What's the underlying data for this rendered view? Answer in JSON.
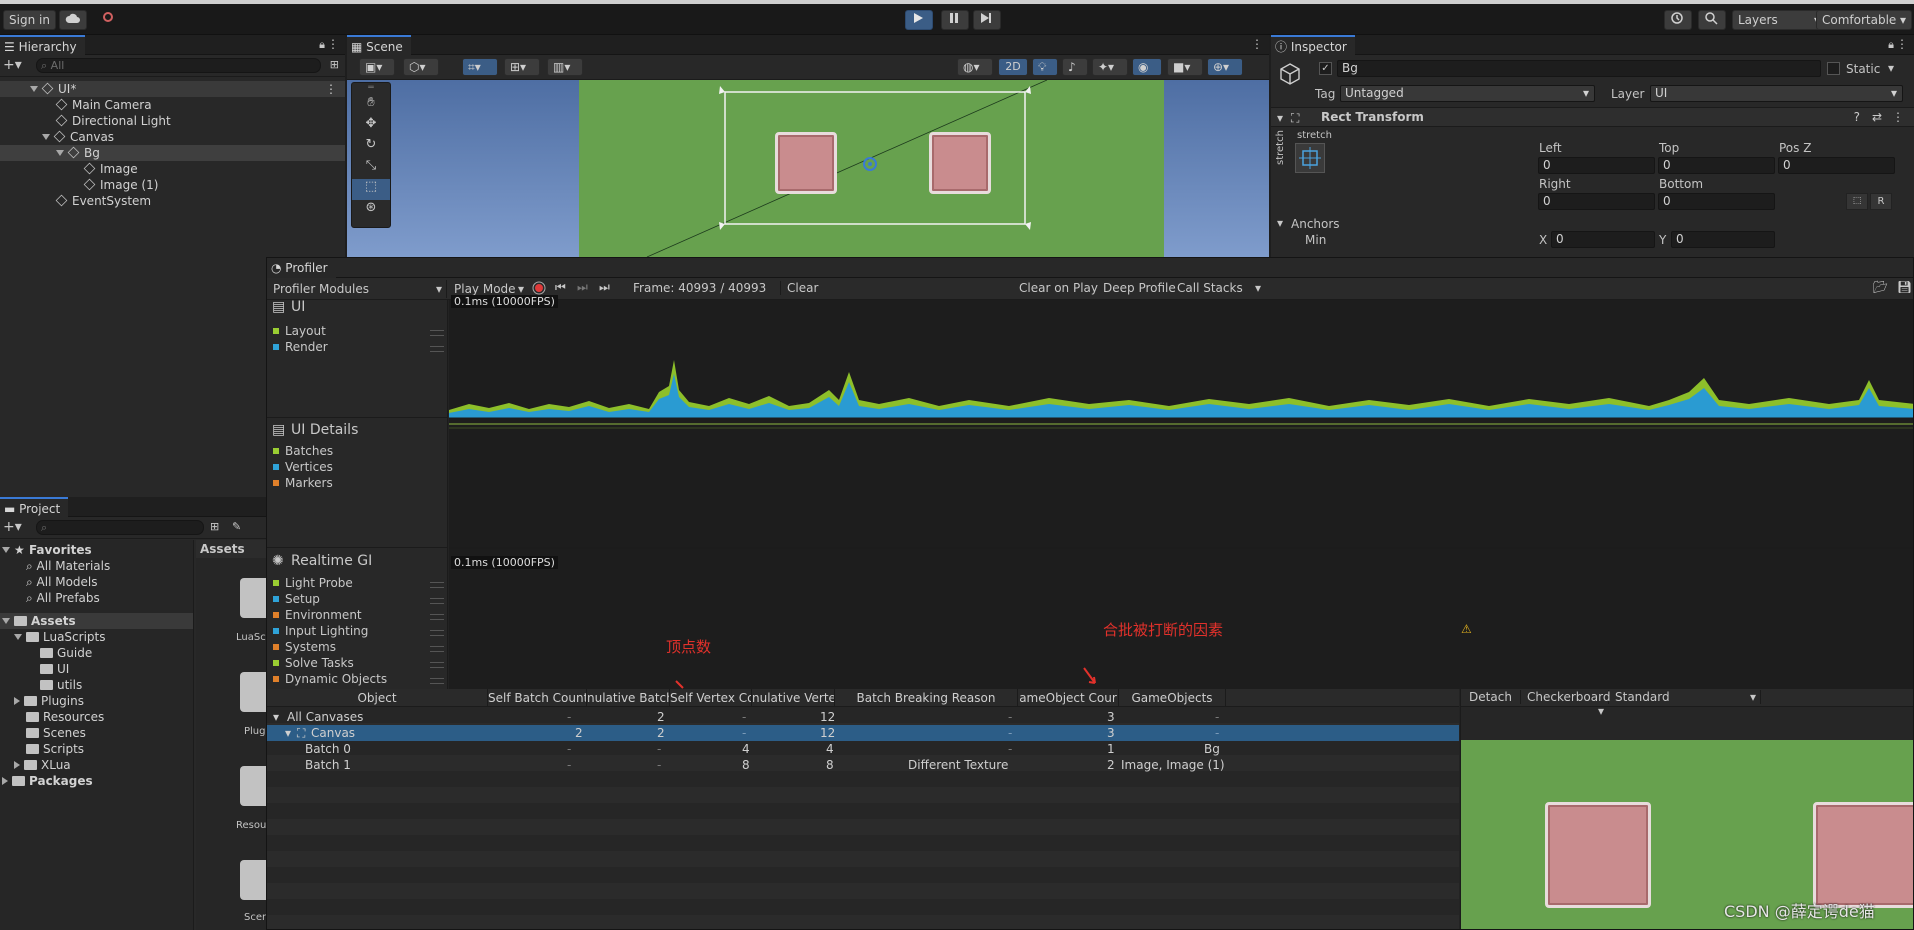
{
  "toolbar": {
    "sign_in": "Sign in",
    "layers": "Layers",
    "layout": "Comfortable"
  },
  "hierarchy": {
    "tab": "Hierarchy",
    "search_placeholder": "All",
    "items": [
      {
        "label": "UI*"
      },
      {
        "label": "Main Camera"
      },
      {
        "label": "Directional Light"
      },
      {
        "label": "Canvas"
      },
      {
        "label": "Bg"
      },
      {
        "label": "Image"
      },
      {
        "label": "Image (1)"
      },
      {
        "label": "EventSystem"
      }
    ]
  },
  "scene": {
    "tab": "Scene",
    "mode_2d": "2D"
  },
  "inspector": {
    "tab": "Inspector",
    "object_name": "Bg",
    "static_label": "Static",
    "tag_label": "Tag",
    "tag_value": "Untagged",
    "layer_label": "Layer",
    "layer_value": "UI",
    "component_title": "Rect Transform",
    "anchor_preset_h": "stretch",
    "anchor_preset_v": "stretch",
    "labels": {
      "left": "Left",
      "top": "Top",
      "posz": "Pos Z",
      "right": "Right",
      "bottom": "Bottom",
      "anchors": "Anchors",
      "min": "Min",
      "x": "X",
      "y": "Y"
    },
    "values": {
      "left": "0",
      "top": "0",
      "posz": "0",
      "right": "0",
      "bottom": "0",
      "min_x": "0",
      "min_y": "0"
    },
    "r_button": "R"
  },
  "project": {
    "tab": "Project",
    "favorites": "Favorites",
    "fav_items": [
      "All Materials",
      "All Models",
      "All Prefabs"
    ],
    "assets": "Assets",
    "tree": [
      {
        "label": "LuaScripts"
      },
      {
        "label": "Guide"
      },
      {
        "label": "UI"
      },
      {
        "label": "utils"
      },
      {
        "label": "Plugins"
      },
      {
        "label": "Resources"
      },
      {
        "label": "Scenes"
      },
      {
        "label": "Scripts"
      },
      {
        "label": "XLua"
      }
    ],
    "packages": "Packages",
    "assets_header": "Assets",
    "asset_labels": [
      "LuaSc",
      "Plugi",
      "Resou",
      "Scen"
    ]
  },
  "profiler": {
    "tab": "Profiler",
    "modules_label": "Profiler Modules",
    "play_mode": "Play Mode",
    "frame": "Frame: 40993 / 40993",
    "clear": "Clear",
    "clear_on_play": "Clear on Play",
    "deep_profile": "Deep Profile",
    "call_stacks": "Call Stacks",
    "ui_module": {
      "title": "UI",
      "items": [
        "Layout",
        "Render"
      ],
      "colors": [
        "#9acd32",
        "#2fa3d8"
      ],
      "time_label": "0.1ms (10000FPS)"
    },
    "ui_details": {
      "title": "UI Details",
      "items": [
        "Batches",
        "Vertices",
        "Markers"
      ],
      "colors": [
        "#9acd32",
        "#2fa3d8",
        "#e0802a"
      ]
    },
    "realtime_gi": {
      "title": "Realtime GI",
      "time_label": "0.1ms (10000FPS)",
      "items": [
        "Light Probe",
        "Setup",
        "Environment",
        "Input Lighting",
        "Systems",
        "Solve Tasks",
        "Dynamic Objects"
      ],
      "colors": [
        "#9acd32",
        "#2fa3d8",
        "#e0802a",
        "#2fa3d8",
        "#e0802a",
        "#9acd32",
        "#e0802a"
      ]
    },
    "annotations": {
      "vertex": "顶点数",
      "batch_reason": "合批被打断的因素"
    },
    "table": {
      "headers": [
        "Object",
        "Self Batch Count",
        "Cumulative Batch Count",
        "Self Vertex Count",
        "Cumulative Vertex Count",
        "Batch Breaking Reason",
        "GameObject Count",
        "GameObjects"
      ],
      "header_display": [
        "Object",
        "Self Batch Count",
        "nulative Batch Co",
        "Self Vertex Coun",
        "nulative Vertex C",
        "Batch Breaking Reason",
        "ameObject Cour",
        "GameObjects"
      ],
      "rows": [
        {
          "object": "All Canvases",
          "self_batch": "-",
          "cum_batch": "2",
          "self_vertex": "-",
          "cum_vertex": "12",
          "reason": "-",
          "go_count": "3",
          "gameobjects": "-"
        },
        {
          "object": "Canvas",
          "self_batch": "2",
          "cum_batch": "2",
          "self_vertex": "-",
          "cum_vertex": "12",
          "reason": "-",
          "go_count": "3",
          "gameobjects": "-"
        },
        {
          "object": "Batch 0",
          "self_batch": "-",
          "cum_batch": "-",
          "self_vertex": "4",
          "cum_vertex": "4",
          "reason": "-",
          "go_count": "1",
          "gameobjects": "Bg"
        },
        {
          "object": "Batch 1",
          "self_batch": "-",
          "cum_batch": "-",
          "self_vertex": "8",
          "cum_vertex": "8",
          "reason": "Different Texture",
          "go_count": "2",
          "gameobjects": "Image, Image (1)"
        }
      ]
    },
    "preview": {
      "detach": "Detach",
      "background": "Checkerboard",
      "shader": "Standard"
    }
  },
  "watermark": "CSDN @薛定谔de猫"
}
